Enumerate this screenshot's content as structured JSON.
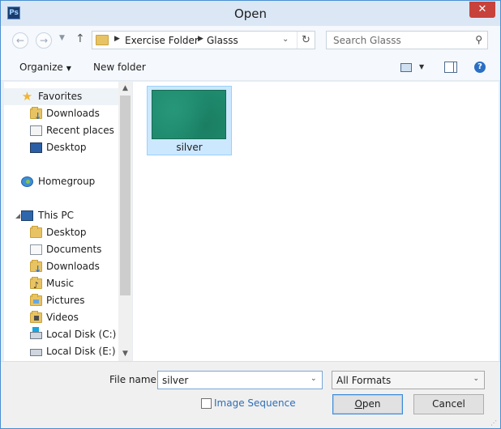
{
  "window": {
    "title": "Open",
    "app_icon_text": "Ps",
    "close_glyph": "✕"
  },
  "nav": {
    "back_glyph": "←",
    "forward_glyph": "→",
    "dropdown_glyph": "▼",
    "up_glyph": "↑",
    "breadcrumb": [
      "Exercise Folder",
      "Glasss"
    ],
    "crumb_separator": "▶",
    "address_dropdown_glyph": "⌄",
    "refresh_glyph": "↻",
    "search_placeholder": "Search Glasss",
    "search_glyph": "⚲"
  },
  "toolbar": {
    "organize_label": "Organize",
    "caret_glyph": "▼",
    "new_folder_label": "New folder",
    "help_glyph": "?"
  },
  "sidebar": {
    "favorites": "Favorites",
    "favorite_items": [
      "Downloads",
      "Recent places",
      "Desktop"
    ],
    "homegroup": "Homegroup",
    "this_pc": "This PC",
    "expander_glyph": "◢",
    "pc_items": [
      "Desktop",
      "Documents",
      "Downloads",
      "Music",
      "Pictures",
      "Videos",
      "Local Disk (C:)",
      "Local Disk (E:)"
    ],
    "icons": {
      "favorites": "star-icon",
      "homegroup": "homegroup-icon",
      "this_pc": "computer-icon"
    }
  },
  "scrollbar": {
    "up_glyph": "▲",
    "down_glyph": "▼"
  },
  "files": [
    {
      "name": "silver",
      "thumb_color": "#1f8a6d"
    }
  ],
  "bottom": {
    "file_name_label": "File name:",
    "file_name_value": "silver",
    "dropdown_glyph": "⌄",
    "format_value": "All Formats",
    "image_sequence_label": "Image Sequence",
    "open_first": "O",
    "open_rest": "pen",
    "cancel_label": "Cancel",
    "grip_glyph": "⋰"
  },
  "colors": {
    "accent": "#1f8fd8",
    "selection": "#cce8ff",
    "link": "#2e6eb6",
    "close": "#c7423b"
  }
}
